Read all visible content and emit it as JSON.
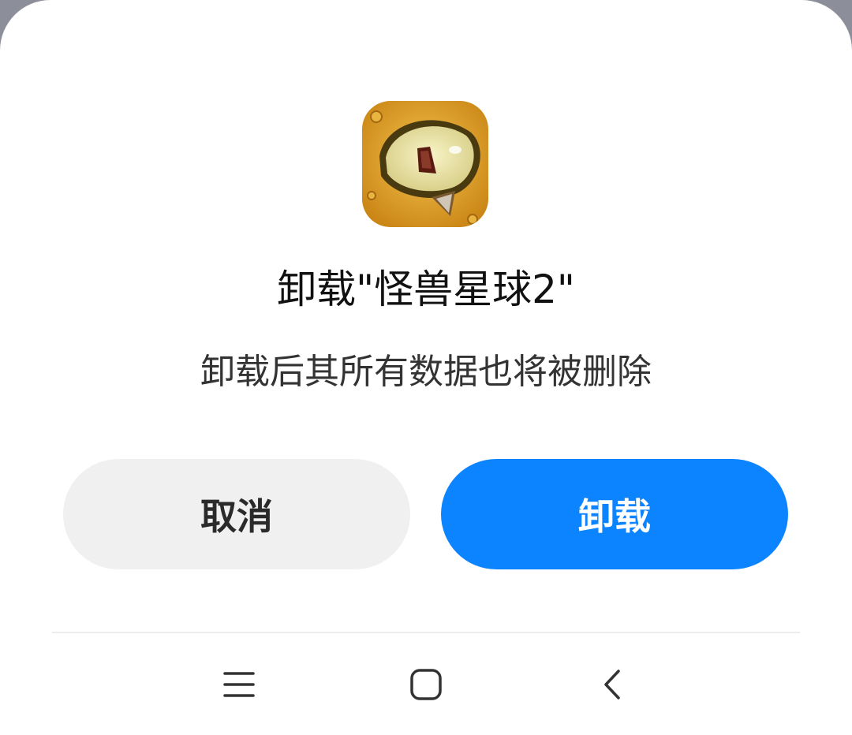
{
  "dialog": {
    "title": "卸载\"怪兽星球2\"",
    "message": "卸载后其所有数据也将被删除",
    "cancel_label": "取消",
    "confirm_label": "卸载",
    "app_icon": "monster-eye-app-icon"
  },
  "colors": {
    "accent": "#0d84ff",
    "cancel_bg": "#f0f0f0",
    "sheet_bg": "#ffffff",
    "backdrop": "#8c8f99"
  },
  "navbar": {
    "icons": [
      "menu-icon",
      "home-icon",
      "back-icon"
    ]
  }
}
